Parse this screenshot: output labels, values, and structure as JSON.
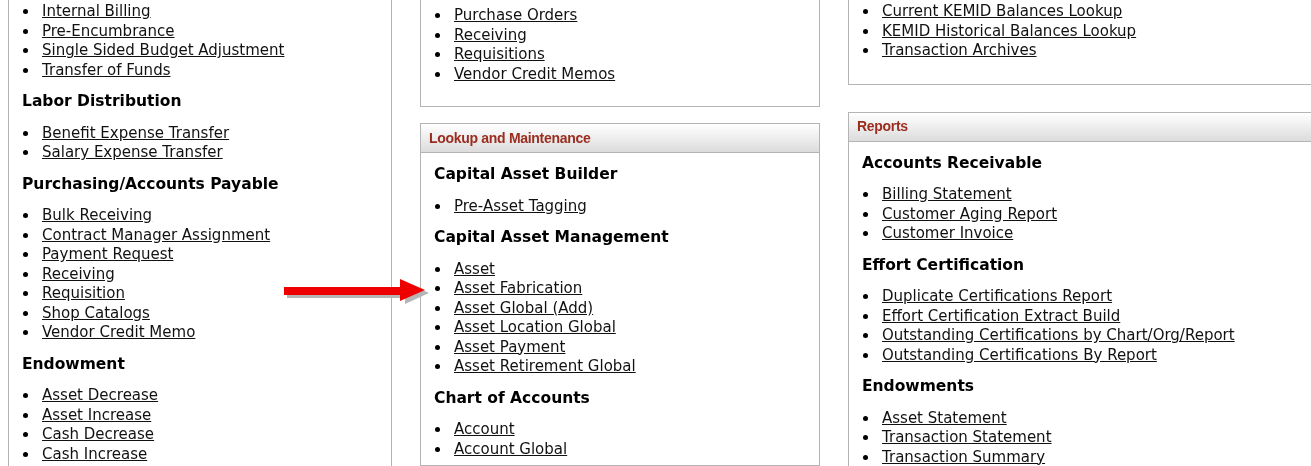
{
  "columns": [
    {
      "panels": [
        {
          "sections": [
            {
              "items": [
                "Internal Billing",
                "Pre-Encumbrance",
                "Single Sided Budget Adjustment",
                "Transfer of Funds"
              ]
            },
            {
              "heading": "Labor Distribution",
              "items": [
                "Benefit Expense Transfer",
                "Salary Expense Transfer"
              ]
            },
            {
              "heading": "Purchasing/Accounts Payable",
              "items": [
                "Bulk Receiving",
                "Contract Manager Assignment",
                "Payment Request",
                "Receiving",
                "Requisition",
                "Shop Catalogs",
                "Vendor Credit Memo"
              ]
            },
            {
              "heading": "Endowment",
              "items": [
                "Asset Decrease",
                "Asset Increase",
                "Cash Decrease",
                "Cash Increase"
              ]
            }
          ]
        }
      ]
    },
    {
      "panels": [
        {
          "sections": [
            {
              "items": [
                "Purchase Orders",
                "Receiving",
                "Requisitions",
                "Vendor Credit Memos"
              ]
            }
          ]
        },
        {
          "title": "Lookup and Maintenance",
          "sections": [
            {
              "heading": "Capital Asset Builder",
              "items": [
                "Pre-Asset Tagging"
              ]
            },
            {
              "heading": "Capital Asset Management",
              "items": [
                "Asset",
                "Asset Fabrication",
                "Asset Global (Add)",
                "Asset Location Global",
                "Asset Payment",
                "Asset Retirement Global"
              ]
            },
            {
              "heading": "Chart of Accounts",
              "items": [
                "Account",
                "Account Global"
              ]
            }
          ]
        }
      ]
    },
    {
      "panels": [
        {
          "sections": [
            {
              "items": [
                "Current KEMID Balances Lookup",
                "KEMID Historical Balances Lookup",
                "Transaction Archives"
              ]
            }
          ]
        },
        {
          "title": "Reports",
          "sections": [
            {
              "heading": "Accounts Receivable",
              "items": [
                "Billing Statement",
                "Customer Aging Report",
                "Customer Invoice"
              ]
            },
            {
              "heading": "Effort Certification",
              "items": [
                "Duplicate Certifications Report",
                "Effort Certification Extract Build",
                "Outstanding Certifications by Chart/Org/Report",
                "Outstanding Certifications By Report"
              ]
            },
            {
              "heading": "Endowments",
              "items": [
                "Asset Statement",
                "Transaction Statement",
                "Transaction Summary"
              ]
            }
          ]
        }
      ]
    }
  ]
}
